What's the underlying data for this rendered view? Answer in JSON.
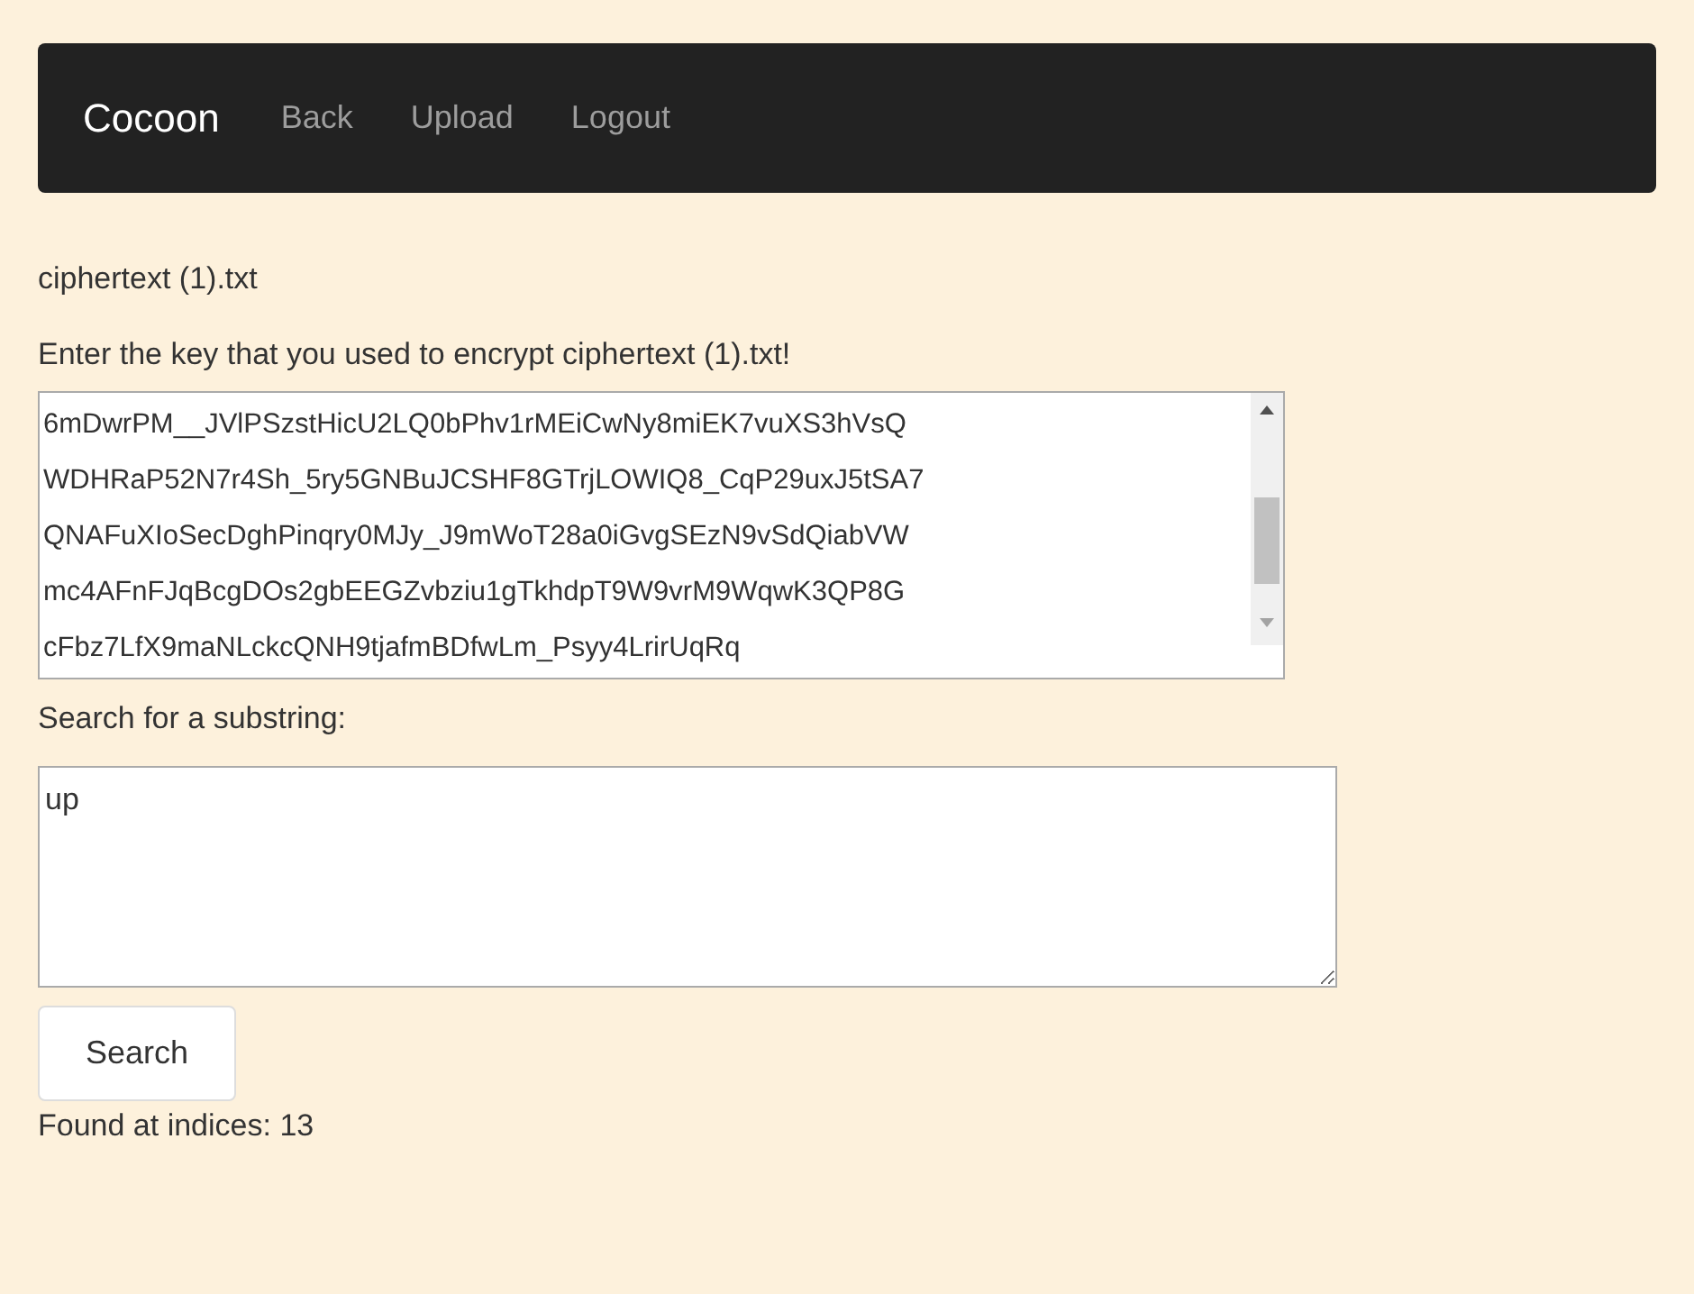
{
  "navbar": {
    "brand": "Cocoon",
    "links": [
      "Back",
      "Upload",
      "Logout"
    ]
  },
  "file_name": "ciphertext (1).txt",
  "prompt": "Enter the key that you used to encrypt ciphertext (1).txt!",
  "key_field": {
    "lines": [
      "6mDwrPM__JVlPSzstHicU2LQ0bPhv1rMEiCwNy8miEK7vuXS3hVsQ",
      "WDHRaP52N7r4Sh_5ry5GNBuJCSHF8GTrjLOWIQ8_CqP29uxJ5tSA7",
      "QNAFuXIoSecDghPinqry0MJy_J9mWoT28a0iGvgSEzN9vSdQiabVW",
      "mc4AFnFJqBcgDOs2gbEEGZvbziu1gTkhdpT9W9vrM9WqwK3QP8G",
      "cFbz7LfX9maNLckcQNH9tjafmBDfwLm_Psyy4LrirUqRq"
    ]
  },
  "search_label": "Search for a substring:",
  "search_field": {
    "value": "up"
  },
  "search_button": "Search",
  "result": "Found at indices: 13"
}
